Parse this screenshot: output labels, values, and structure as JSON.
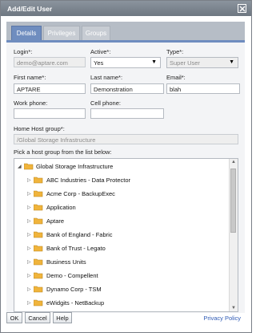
{
  "window": {
    "title": "Add/Edit User"
  },
  "tabs": [
    {
      "label": "Details",
      "active": true
    },
    {
      "label": "Privileges",
      "active": false
    },
    {
      "label": "Groups",
      "active": false
    }
  ],
  "form": {
    "login_label": "Login*:",
    "login_value": "demo@aptare.com",
    "active_label": "Active*:",
    "active_value": "Yes",
    "type_label": "Type*:",
    "type_value": "Super User",
    "first_name_label": "First name*:",
    "first_name_value": "APTARE",
    "last_name_label": "Last name*:",
    "last_name_value": "Demonstration",
    "email_label": "Email*:",
    "email_value": "blah",
    "work_phone_label": "Work phone:",
    "work_phone_value": "",
    "cell_phone_label": "Cell phone:",
    "cell_phone_value": "",
    "home_host_label": "Home Host group*:",
    "home_host_value": "/Global Storage Infrastructure",
    "pick_label": "Pick a host group from the list below:"
  },
  "tree": {
    "root": "Global Storage Infrastructure",
    "items": [
      "ABC Industries - Data Protector",
      "Acme Corp - BackupExec",
      "Application",
      "Aptare",
      "Bank of England - Fabric",
      "Bank of Trust - Legato",
      "Business Units",
      "Demo - Compellent",
      "Dynamo Corp - TSM",
      "eWidgits - NetBackup"
    ]
  },
  "footer": {
    "ok_label": "OK",
    "cancel_label": "Cancel",
    "help_label": "Help",
    "privacy_label": "Privacy Policy"
  },
  "colors": {
    "titlebar": "#7d8590",
    "tab_active": "#6f8dbf",
    "folder": "#f0b43c",
    "link": "#2f5bb5"
  }
}
